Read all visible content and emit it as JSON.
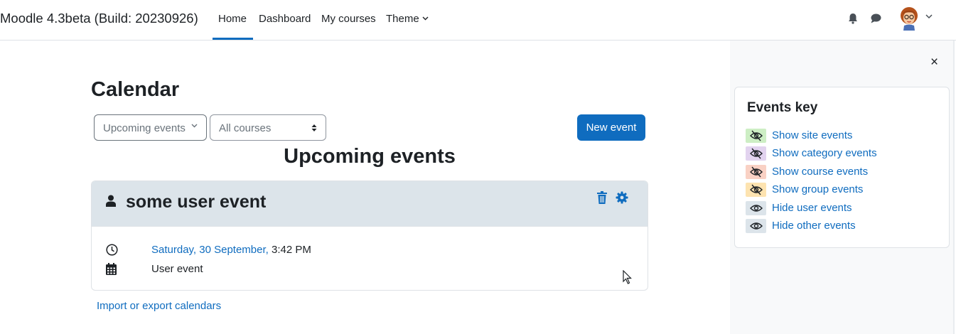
{
  "navbar": {
    "brand": "Moodle 4.3beta (Build: 20230926)",
    "items": [
      {
        "label": "Home"
      },
      {
        "label": "Dashboard"
      },
      {
        "label": "My courses"
      },
      {
        "label": "Theme"
      }
    ]
  },
  "main": {
    "title": "Calendar",
    "view_select": "Upcoming events",
    "course_select": "All courses",
    "new_event_button": "New event",
    "section_title": "Upcoming events",
    "event": {
      "name": "some user event",
      "date_link": "Saturday, 30 September,",
      "time": " 3:42 PM",
      "type": "User event"
    },
    "import_export_link": "Import or export calendars"
  },
  "drawer": {
    "close": "×",
    "events_key": {
      "title": "Events key",
      "items": [
        {
          "label": "Show site events",
          "color": "#cdeec4"
        },
        {
          "label": "Show category events",
          "color": "#e2d3ef"
        },
        {
          "label": "Show course events",
          "color": "#f9d1c4"
        },
        {
          "label": "Show group events",
          "color": "#fde3b0"
        },
        {
          "label": "Hide user events",
          "color": "#dce4ea"
        },
        {
          "label": "Hide other events",
          "color": "#dce4ea"
        }
      ]
    }
  },
  "colors": {
    "accent": "#0f6cbf",
    "event_header": "#dce4ea"
  }
}
